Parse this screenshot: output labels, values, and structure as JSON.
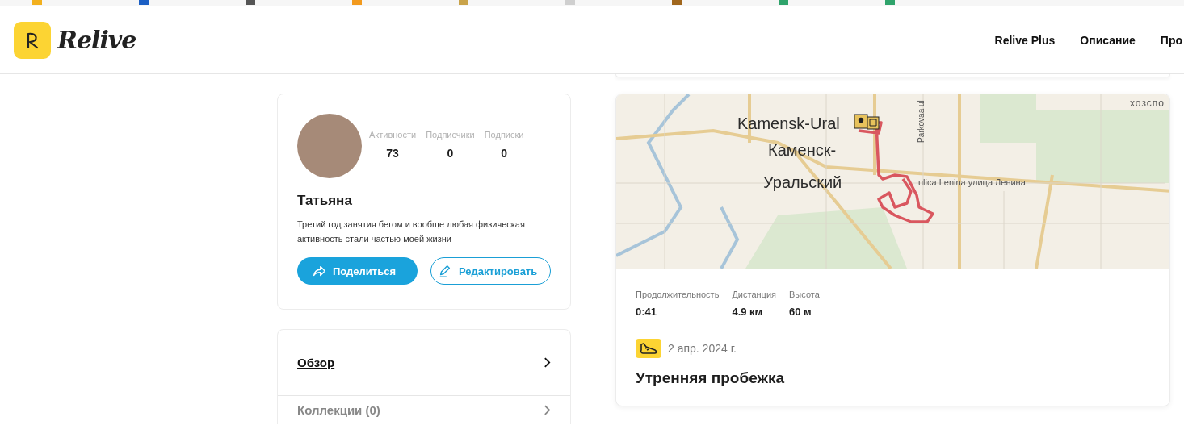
{
  "header": {
    "logo": "Relive",
    "nav": [
      {
        "label": "Relive Plus"
      },
      {
        "label": "Описание"
      },
      {
        "label": "Про"
      }
    ]
  },
  "profile": {
    "stats": [
      {
        "label": "Активности",
        "value": "73"
      },
      {
        "label": "Подписчики",
        "value": "0"
      },
      {
        "label": "Подписки",
        "value": "0"
      }
    ],
    "name": "Татьяна",
    "bio": "Третий год занятия бегом и вообще любая физическая активность стали частью моей жизни",
    "buttons": [
      {
        "kind": "primary",
        "label": "Поделиться"
      },
      {
        "kind": "outline",
        "label": "Редактировать"
      }
    ]
  },
  "profile_menu": [
    {
      "label": "Обзор",
      "selected": true
    },
    {
      "label": "Коллекции (0)",
      "selected": false
    }
  ],
  "activity": {
    "map": {
      "labels": [
        {
          "kind": "city",
          "text": "Kamensk-Ural"
        },
        {
          "kind": "city",
          "text": "Каменск-"
        },
        {
          "kind": "city",
          "text": "Уральский"
        },
        {
          "kind": "street_vertical",
          "text": "Parkovaa ul"
        },
        {
          "kind": "street",
          "text": "ulica Lenina улица Ленина"
        },
        {
          "kind": "district",
          "text": "хозспо"
        }
      ]
    },
    "stats": [
      {
        "label": "Продолжительность",
        "value": "0:41"
      },
      {
        "label": "Дистанция",
        "value": "4.9 км"
      },
      {
        "label": "Высота",
        "value": "60 м"
      }
    ],
    "date": "2 апр. 2024 г.",
    "title": "Утренняя пробежка"
  }
}
